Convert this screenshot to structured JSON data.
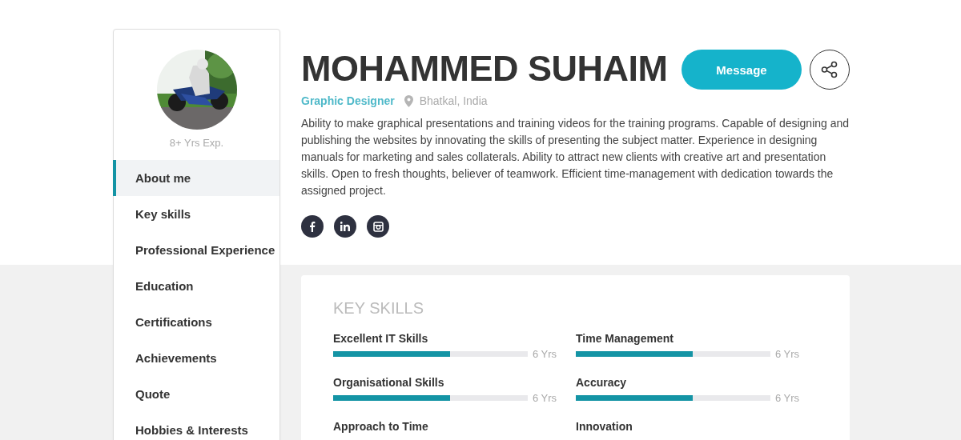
{
  "profile": {
    "experience": "8+ Yrs Exp.",
    "name": "MOHAMMED SUHAIM",
    "role": "Graphic Designer",
    "location": "Bhatkal, India",
    "about": "Ability to make graphical presentations and training videos for the training programs. Capable of designing and publishing the websites by innovating the skills of presenting the subject matter. Experience in designing manuals for marketing and sales collaterals. Ability to attract new clients with creative art and presentation skills. Open to fresh thoughts, believer of teamwork. Efficient time-management with dedication towards the assigned project.",
    "message_button": "Message"
  },
  "social": [
    {
      "kind": "facebook"
    },
    {
      "kind": "linkedin"
    },
    {
      "kind": "instagram"
    }
  ],
  "nav": [
    {
      "label": "About me",
      "selected": true
    },
    {
      "label": "Key skills",
      "selected": false
    },
    {
      "label": "Professional Experience",
      "selected": false
    },
    {
      "label": "Education",
      "selected": false
    },
    {
      "label": "Certifications",
      "selected": false
    },
    {
      "label": "Achievements",
      "selected": false
    },
    {
      "label": "Quote",
      "selected": false
    },
    {
      "label": "Hobbies & Interests",
      "selected": false
    }
  ],
  "key_skills": {
    "title": "KEY SKILLS",
    "skills": [
      {
        "name": "Excellent IT Skills",
        "level": 0.6,
        "years": "6 Yrs"
      },
      {
        "name": "Time Management",
        "level": 0.6,
        "years": "6 Yrs"
      },
      {
        "name": "Organisational Skills",
        "level": 0.6,
        "years": "6 Yrs"
      },
      {
        "name": "Accuracy",
        "level": 0.6,
        "years": "6 Yrs"
      },
      {
        "name": "Approach to Time"
      },
      {
        "name": "Innovation"
      }
    ]
  }
}
